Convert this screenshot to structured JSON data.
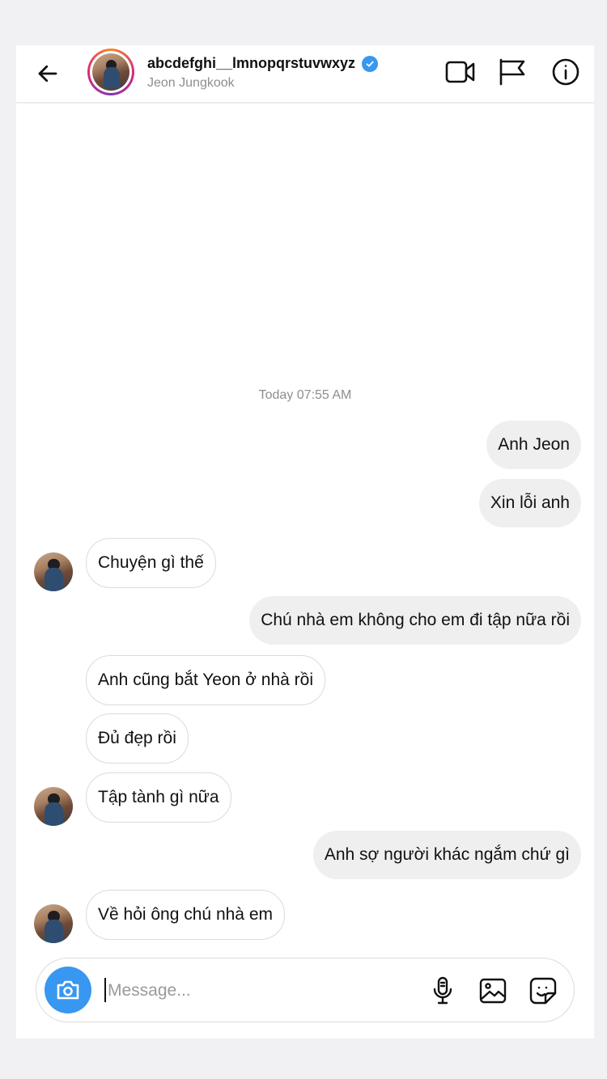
{
  "header": {
    "username": "abcdefghi__lmnopqrstuvwxyz",
    "display_name": "Jeon Jungkook"
  },
  "chat": {
    "timestamp": "Today 07:55 AM",
    "messages": [
      {
        "dir": "out",
        "text": "Anh Jeon"
      },
      {
        "dir": "out",
        "text": "Xin lỗi anh"
      },
      {
        "dir": "in",
        "text": "Chuyện gì thế"
      },
      {
        "dir": "out",
        "text": "Chú nhà em không cho em đi tập nữa rồi"
      },
      {
        "dir": "in",
        "text": "Anh cũng bắt Yeon ở nhà rồi"
      },
      {
        "dir": "in",
        "text": "Đủ đẹp rồi"
      },
      {
        "dir": "in",
        "text": "Tập tành gì nữa"
      },
      {
        "dir": "out",
        "text": "Anh sợ người khác ngắm chứ gì"
      },
      {
        "dir": "in",
        "text": "Về hỏi ông chú nhà em"
      }
    ]
  },
  "composer": {
    "placeholder": "Message...",
    "value": ""
  },
  "icons": {
    "back": "arrow-left-icon",
    "video": "video-camera-icon",
    "report": "flag-icon",
    "info": "info-icon",
    "camera": "camera-icon",
    "mic": "microphone-icon",
    "gallery": "image-icon",
    "sticker": "sticker-icon",
    "verified": "verified-badge-icon"
  },
  "colors": {
    "accent": "#3897f0",
    "outgoing_bubble": "#efefef",
    "incoming_border": "#dbdbdb",
    "muted_text": "#8e8e8e"
  }
}
